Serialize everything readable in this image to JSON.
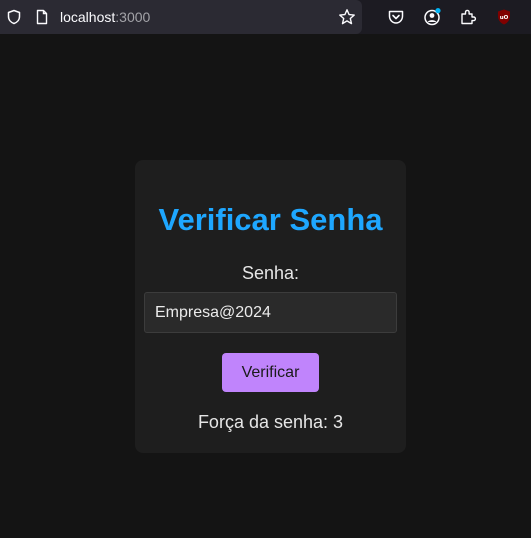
{
  "browser": {
    "url_host": "localhost",
    "url_port": ":3000",
    "icons": [
      "shield-icon",
      "page-icon",
      "bookmark-star-icon",
      "pocket-icon",
      "account-icon",
      "extensions-icon",
      "ublock-icon"
    ]
  },
  "card": {
    "title": "Verificar Senha",
    "field_label": "Senha:",
    "password_value": "Empresa@2024",
    "button_label": "Verificar",
    "result_label": "Força da senha:",
    "result_value": "3"
  },
  "colors": {
    "background": "#141414",
    "card": "#1e1e1e",
    "title": "#1ea7ff",
    "button": "#c084fc"
  }
}
